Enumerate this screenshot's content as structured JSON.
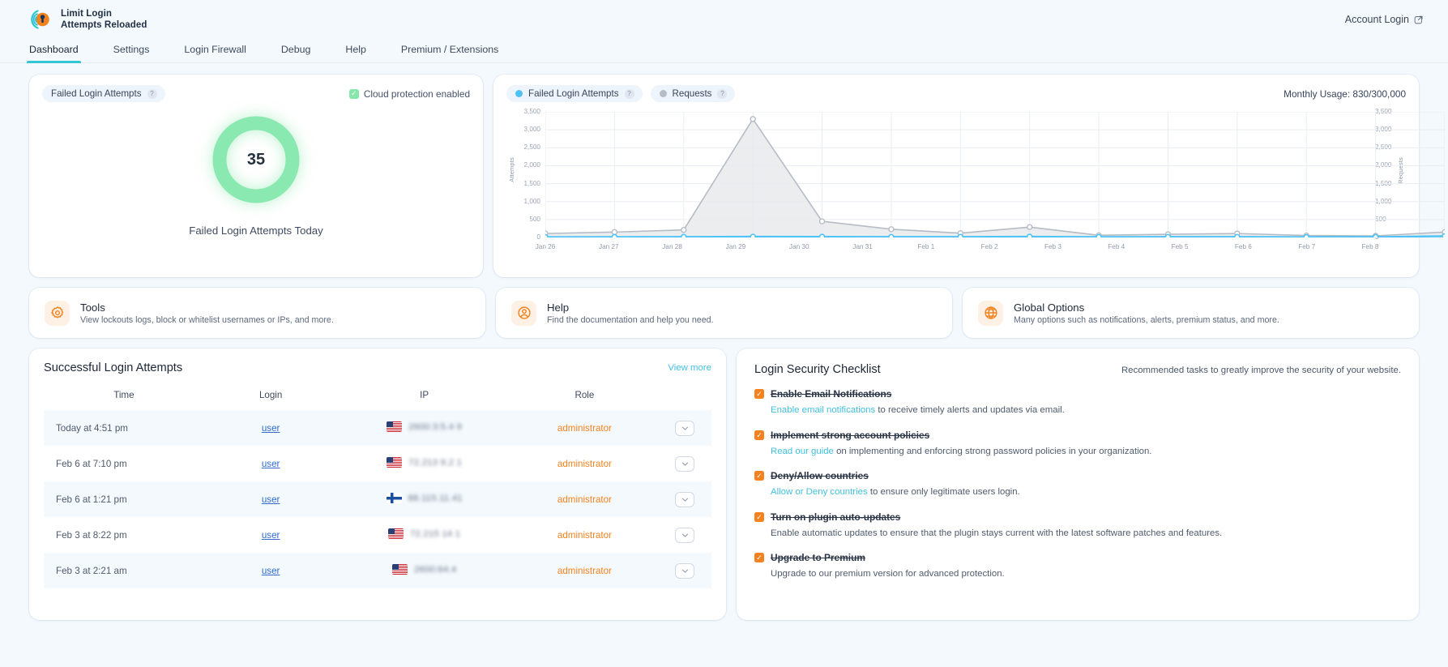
{
  "brand": {
    "line1": "Limit Login",
    "line2": "Attempts Reloaded"
  },
  "header": {
    "account_login": "Account Login",
    "external_icon": "external-link-icon"
  },
  "nav": {
    "tabs": [
      {
        "label": "Dashboard",
        "active": true
      },
      {
        "label": "Settings",
        "active": false
      },
      {
        "label": "Login Firewall",
        "active": false
      },
      {
        "label": "Debug",
        "active": false
      },
      {
        "label": "Help",
        "active": false
      },
      {
        "label": "Premium / Extensions",
        "active": false
      }
    ]
  },
  "gauge_card": {
    "chip_label": "Failed Login Attempts",
    "cloud_status": "Cloud protection enabled",
    "value": "35",
    "caption": "Failed Login Attempts Today",
    "ring_color": "#8ae9b0"
  },
  "chart_card": {
    "legend": [
      {
        "label": "Failed Login Attempts",
        "color": "#4fc3f7"
      },
      {
        "label": "Requests",
        "color": "#b6bcc6"
      }
    ],
    "monthly_usage": "Monthly Usage: 830/300,000"
  },
  "chart_data": {
    "type": "line",
    "title": "",
    "xlabel": "",
    "ylabel": "Attempts",
    "y2label": "Requests",
    "ylim": [
      0,
      3500
    ],
    "yticks": [
      "0",
      "500",
      "1,000",
      "1,500",
      "2,000",
      "2,500",
      "3,000",
      "3,500"
    ],
    "grid": true,
    "legend_position": "top-left",
    "categories": [
      "Jan 26",
      "Jan 27",
      "Jan 28",
      "Jan 29",
      "Jan 30",
      "Jan 31",
      "Feb 1",
      "Feb 2",
      "Feb 3",
      "Feb 4",
      "Feb 5",
      "Feb 6",
      "Feb 7",
      "Feb 8"
    ],
    "series": [
      {
        "name": "Failed Login Attempts",
        "color": "#4fc3f7",
        "values": [
          10,
          12,
          15,
          20,
          18,
          14,
          16,
          22,
          12,
          15,
          14,
          11,
          13,
          35
        ]
      },
      {
        "name": "Requests",
        "color": "#b6bcc6",
        "values": [
          110,
          150,
          210,
          3300,
          450,
          230,
          120,
          290,
          60,
          90,
          110,
          55,
          45,
          150
        ]
      }
    ]
  },
  "info_cards": [
    {
      "icon": "gear-icon",
      "title": "Tools",
      "subtitle": "View lockouts logs, block or whitelist usernames or IPs, and more."
    },
    {
      "icon": "user-circle-icon",
      "title": "Help",
      "subtitle": "Find the documentation and help you need."
    },
    {
      "icon": "globe-icon",
      "title": "Global Options",
      "subtitle": "Many options such as notifications, alerts, premium status, and more."
    }
  ],
  "table": {
    "title": "Successful Login Attempts",
    "view_more": "View more",
    "columns": [
      "Time",
      "Login",
      "IP",
      "Role"
    ],
    "rows": [
      {
        "time": "Today at 4:51 pm",
        "login": "user",
        "flag": "us",
        "ip": "2600:3:5.4  9",
        "role": "administrator"
      },
      {
        "time": "Feb 6 at 7:10 pm",
        "login": "user",
        "flag": "us",
        "ip": "72.213 9.2 1",
        "role": "administrator"
      },
      {
        "time": "Feb 6 at 1:21 pm",
        "login": "user",
        "flag": "fi",
        "ip": "88.115.11.41",
        "role": "administrator"
      },
      {
        "time": "Feb 3 at 8:22 pm",
        "login": "user",
        "flag": "us",
        "ip": "72.215 14 1",
        "role": "administrator"
      },
      {
        "time": "Feb 3 at 2:21 am",
        "login": "user",
        "flag": "us",
        "ip": "2600:64.4",
        "role": "administrator"
      }
    ]
  },
  "checklist": {
    "title": "Login Security Checklist",
    "subtitle": "Recommended tasks to greatly improve the security of your website.",
    "items": [
      {
        "name": "Enable Email Notifications",
        "link": "Enable email notifications",
        "desc_after": " to receive timely alerts and updates via email.",
        "checked": true
      },
      {
        "name": "Implement strong account policies",
        "link": "Read our guide",
        "desc_after": " on implementing and enforcing strong password policies in your organization.",
        "checked": true
      },
      {
        "name": "Deny/Allow countries",
        "link": "Allow or Deny countries",
        "desc_after": " to ensure only legitimate users login.",
        "checked": true
      },
      {
        "name": "Turn on plugin auto-updates",
        "link": "",
        "desc_after": "Enable automatic updates to ensure that the plugin stays current with the latest software patches and features.",
        "checked": true
      },
      {
        "name": "Upgrade to Premium",
        "link": "",
        "desc_after": "Upgrade to our premium version for advanced protection.",
        "checked": true
      }
    ]
  }
}
